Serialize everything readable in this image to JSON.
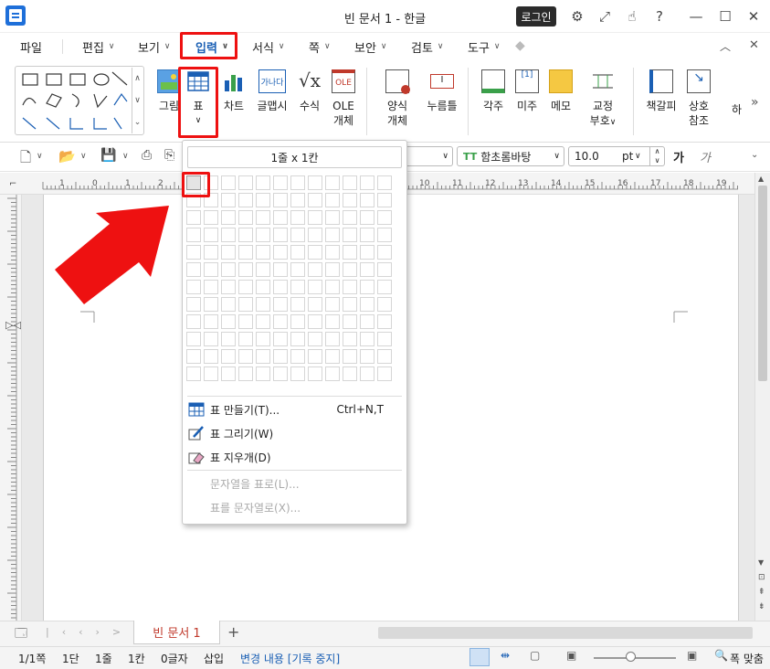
{
  "window": {
    "title": "빈 문서 1 - 한글",
    "login_label": "로그인"
  },
  "menu": {
    "items": [
      {
        "label": "파일"
      },
      {
        "label": "편집"
      },
      {
        "label": "보기"
      },
      {
        "label": "입력"
      },
      {
        "label": "서식"
      },
      {
        "label": "쪽"
      },
      {
        "label": "보안"
      },
      {
        "label": "검토"
      },
      {
        "label": "도구"
      }
    ]
  },
  "ribbon": {
    "image": "그림",
    "table": "표",
    "chart": "차트",
    "glyph": "글맵시",
    "formula": "수식",
    "ole_line1": "OLE",
    "ole_line2": "개체",
    "form_line1": "양식",
    "form_line2": "개체",
    "button": "누름틀",
    "footnote": "각주",
    "endnote": "미주",
    "memo": "메모",
    "proof_line1": "교정",
    "proof_line2": "부호",
    "bookmark": "책갈피",
    "crossref_line1": "상호",
    "crossref_line2": "참조",
    "more": "하"
  },
  "format": {
    "font_name": "함초롬바탕",
    "font_size": "10.0",
    "size_unit": "pt",
    "bold_label": "가",
    "italic_label": "가"
  },
  "ruler": {
    "numbers": [
      "1",
      "0",
      "1",
      "2",
      "10",
      "11",
      "12",
      "13",
      "14",
      "15",
      "16",
      "17",
      "18",
      "19"
    ]
  },
  "dropdown": {
    "grid_label": "1줄 x 1칸",
    "grid_rows": 12,
    "grid_cols": 12,
    "items": [
      {
        "label": "표 만들기(T)...",
        "shortcut": "Ctrl+N,T",
        "icon": "table-icon",
        "enabled": true
      },
      {
        "label": "표 그리기(W)",
        "shortcut": "",
        "icon": "pencil-icon",
        "enabled": true
      },
      {
        "label": "표 지우개(D)",
        "shortcut": "",
        "icon": "eraser-icon",
        "enabled": true
      },
      {
        "label": "문자열을 표로(L)...",
        "shortcut": "",
        "icon": "",
        "enabled": false
      },
      {
        "label": "표를 문자열로(X)...",
        "shortcut": "",
        "icon": "",
        "enabled": false
      }
    ]
  },
  "tabs": {
    "doc_name": "빈 문서 1"
  },
  "status": {
    "page": "1/1쪽",
    "section": "1단",
    "line": "1줄",
    "col": "1칸",
    "chars": "0글자",
    "mode": "삽입",
    "track": "변경 내용 [기록 중지]",
    "zoom": "폭 맞춤"
  },
  "colors": {
    "highlight": "#e11111",
    "accent": "#1a5fb4"
  }
}
